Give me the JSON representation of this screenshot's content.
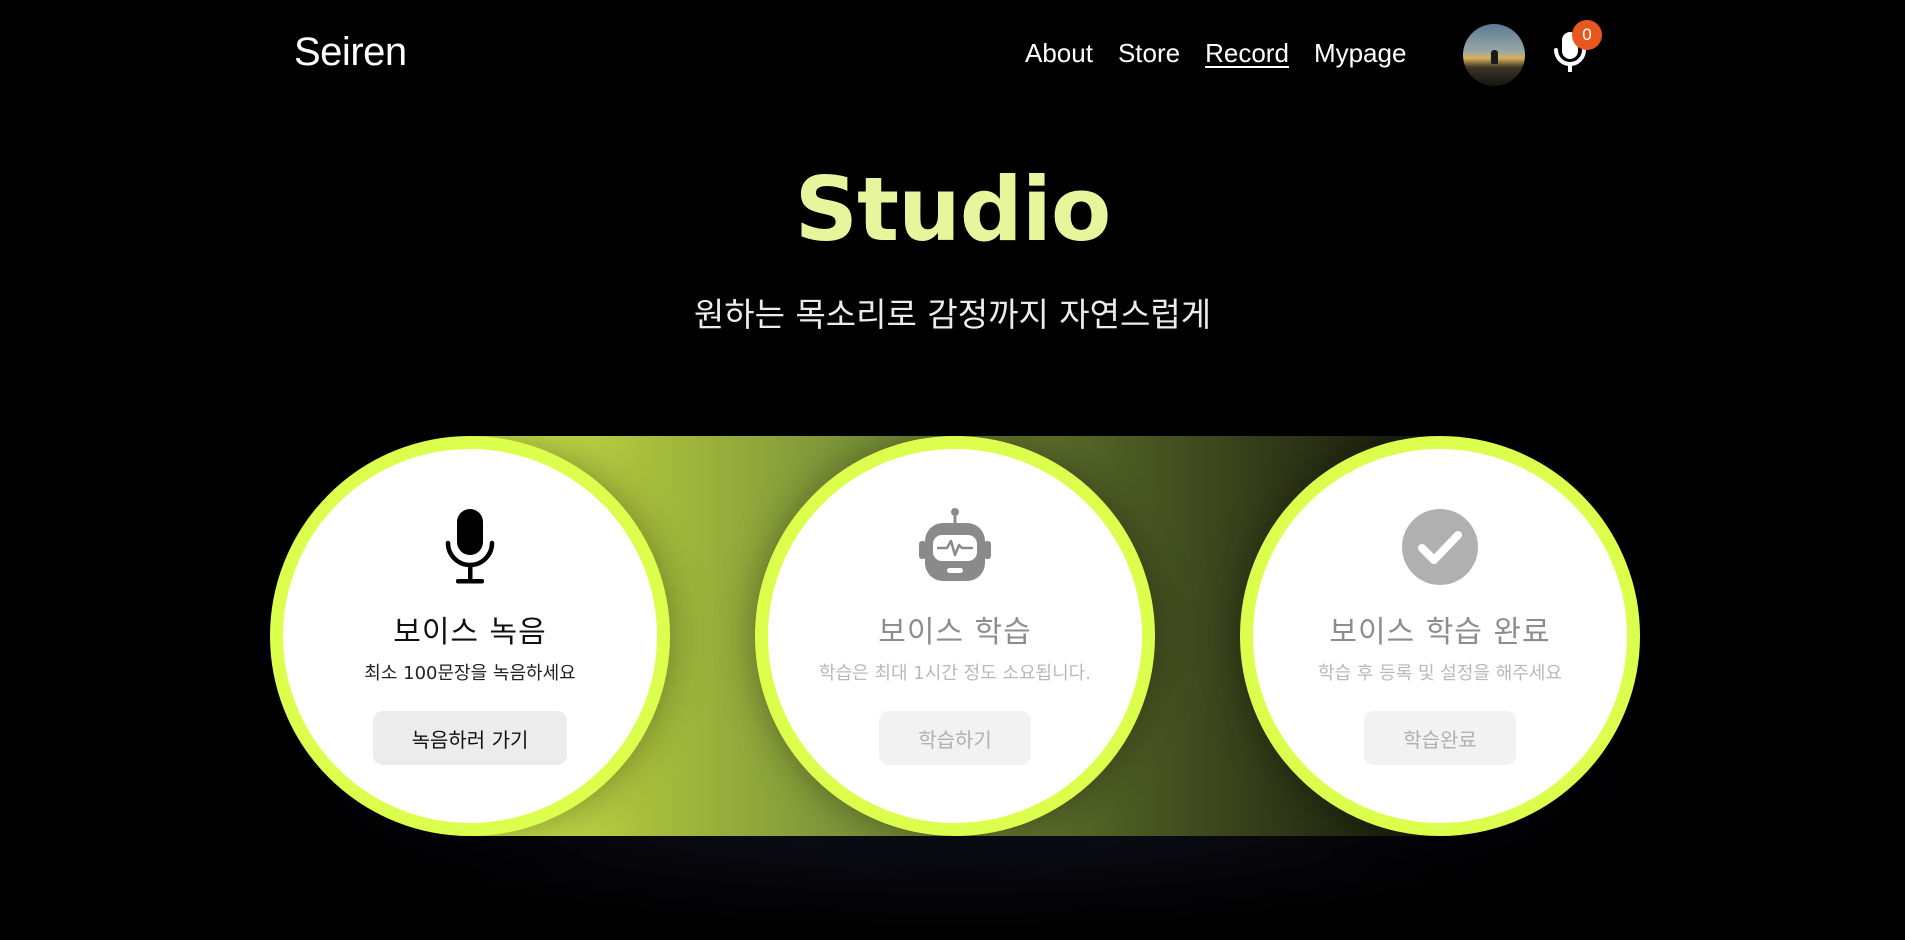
{
  "header": {
    "logo": "Seiren",
    "nav": [
      "About",
      "Store",
      "Record",
      "Mypage"
    ],
    "active_nav": "Record",
    "badge_count": "0"
  },
  "hero": {
    "title": "Studio",
    "subtitle": "원하는 목소리로 감정까지 자연스럽게"
  },
  "steps": [
    {
      "icon": "microphone-icon",
      "title": "보이스 녹음",
      "desc": "최소 100문장을 녹음하세요",
      "button": "녹음하러 가기",
      "enabled": true
    },
    {
      "icon": "robot-icon",
      "title": "보이스 학습",
      "desc": "학습은 최대 1시간 정도 소요됩니다.",
      "button": "학습하기",
      "enabled": false
    },
    {
      "icon": "check-circle-icon",
      "title": "보이스 학습 완료",
      "desc": "학습 후 등록 및 설정을 해주세요",
      "button": "학습완료",
      "enabled": false
    }
  ],
  "colors": {
    "accent": "#dcff4d",
    "title": "#e9f59c",
    "badge": "#e8571e",
    "background": "#000000"
  }
}
